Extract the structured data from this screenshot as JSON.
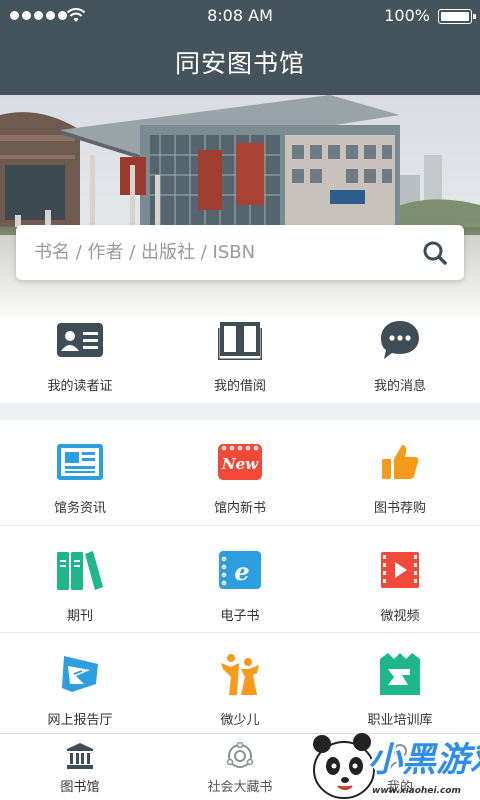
{
  "status_bar": {
    "time": "8:08 AM",
    "battery": "100%",
    "signal_icon": "signal-dots-icon",
    "wifi_icon": "wifi-icon",
    "battery_icon": "battery-icon"
  },
  "header": {
    "title": "同安图书馆"
  },
  "banner": {
    "image": "library-building-photo"
  },
  "search": {
    "placeholder": "书名 / 作者 / 出版社 / ISBN",
    "value": "",
    "icon": "search-icon"
  },
  "quick_actions": [
    {
      "label": "我的读者证",
      "icon": "reader-card-icon"
    },
    {
      "label": "我的借阅",
      "icon": "open-book-icon"
    },
    {
      "label": "我的消息",
      "icon": "chat-bubble-icon"
    }
  ],
  "grid": [
    {
      "label": "馆务资讯",
      "icon": "newspaper-icon"
    },
    {
      "label": "馆内新书",
      "icon": "new-badge-icon",
      "badge_text": "New"
    },
    {
      "label": "图书荐购",
      "icon": "thumbs-up-icon"
    },
    {
      "label": "期刊",
      "icon": "journals-icon"
    },
    {
      "label": "电子书",
      "icon": "ebook-icon",
      "badge_text": "e"
    },
    {
      "label": "微视频",
      "icon": "video-icon"
    },
    {
      "label": "网上报告厅",
      "icon": "lecture-hall-icon"
    },
    {
      "label": "微少儿",
      "icon": "children-icon"
    },
    {
      "label": "职业培训库",
      "icon": "training-icon"
    }
  ],
  "tabs": [
    {
      "label": "图书馆",
      "icon": "library-icon",
      "active": true
    },
    {
      "label": "社会大藏书",
      "icon": "community-books-icon",
      "active": false
    },
    {
      "label": "我的",
      "icon": "profile-icon",
      "active": false
    }
  ],
  "watermark": {
    "text": "小黑游戏",
    "url": "www.xiaohei.com"
  },
  "colors": {
    "header": "#45535c",
    "icon_dark": "#3f4d57",
    "icon_blue": "#2d9ee0",
    "icon_red": "#f0493a",
    "icon_orange": "#f59a1b",
    "icon_green": "#1eb68a",
    "gap": "#eef0f3"
  }
}
